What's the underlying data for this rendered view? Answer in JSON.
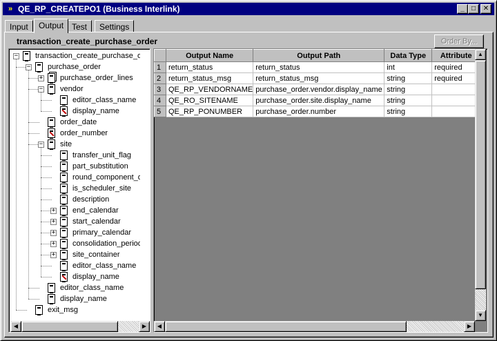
{
  "window": {
    "title": "QE_RP_CREATEPO1 (Business Interlink)",
    "controls": {
      "minimize": "_",
      "maximize": "□",
      "close": "✕"
    }
  },
  "tabs": [
    {
      "label": "Input",
      "active": false
    },
    {
      "label": "Output",
      "active": true
    },
    {
      "label": "Test",
      "active": false
    },
    {
      "label": "Settings",
      "active": false
    }
  ],
  "panel": {
    "title": "transaction_create_purchase_order",
    "order_by_label": "Order By..."
  },
  "tree": {
    "nodes": [
      {
        "label": "transaction_create_purchase_order",
        "level": 0,
        "expander": "−",
        "icon": "doc"
      },
      {
        "label": "purchase_order",
        "level": 1,
        "expander": "−",
        "icon": "doc"
      },
      {
        "label": "purchase_order_lines",
        "level": 2,
        "expander": "+",
        "icon": "multi-doc"
      },
      {
        "label": "vendor",
        "level": 2,
        "expander": "−",
        "icon": "doc"
      },
      {
        "label": "editor_class_name",
        "level": 3,
        "expander": "",
        "icon": "doc"
      },
      {
        "label": "display_name",
        "level": 3,
        "expander": "",
        "icon": "doc-red"
      },
      {
        "label": "order_date",
        "level": 2,
        "expander": "",
        "icon": "doc"
      },
      {
        "label": "order_number",
        "level": 2,
        "expander": "",
        "icon": "doc-red"
      },
      {
        "label": "site",
        "level": 2,
        "expander": "−",
        "icon": "doc"
      },
      {
        "label": "transfer_unit_flag",
        "level": 3,
        "expander": "",
        "icon": "doc"
      },
      {
        "label": "part_substitution",
        "level": 3,
        "expander": "",
        "icon": "doc"
      },
      {
        "label": "round_component_de",
        "level": 3,
        "expander": "",
        "icon": "doc"
      },
      {
        "label": "is_scheduler_site",
        "level": 3,
        "expander": "",
        "icon": "doc"
      },
      {
        "label": "description",
        "level": 3,
        "expander": "",
        "icon": "doc"
      },
      {
        "label": "end_calendar",
        "level": 3,
        "expander": "+",
        "icon": "doc"
      },
      {
        "label": "start_calendar",
        "level": 3,
        "expander": "+",
        "icon": "doc"
      },
      {
        "label": "primary_calendar",
        "level": 3,
        "expander": "+",
        "icon": "doc"
      },
      {
        "label": "consolidation_period_",
        "level": 3,
        "expander": "+",
        "icon": "doc"
      },
      {
        "label": "site_container",
        "level": 3,
        "expander": "+",
        "icon": "doc"
      },
      {
        "label": "editor_class_name",
        "level": 3,
        "expander": "",
        "icon": "doc"
      },
      {
        "label": "display_name",
        "level": 3,
        "expander": "",
        "icon": "doc-red"
      },
      {
        "label": "editor_class_name",
        "level": 2,
        "expander": "",
        "icon": "doc"
      },
      {
        "label": "display_name",
        "level": 2,
        "expander": "",
        "icon": "doc"
      },
      {
        "label": "exit_msg",
        "level": 1,
        "expander": "",
        "icon": "doc"
      }
    ]
  },
  "grid": {
    "columns": [
      "Output Name",
      "Output Path",
      "Data Type",
      "Attribute"
    ],
    "rows": [
      {
        "num": "1",
        "name": "return_status",
        "path": "return_status",
        "type": "int",
        "attr": "required"
      },
      {
        "num": "2",
        "name": "return_status_msg",
        "path": "return_status_msg",
        "type": "string",
        "attr": "required"
      },
      {
        "num": "3",
        "name": "QE_RP_VENDORNAME",
        "path": "purchase_order.vendor.display_name",
        "type": "string",
        "attr": ""
      },
      {
        "num": "4",
        "name": "QE_RO_SITENAME",
        "path": "purchase_order.site.display_name",
        "type": "string",
        "attr": ""
      },
      {
        "num": "5",
        "name": "QE_RP_PONUMBER",
        "path": "purchase_order.number",
        "type": "string",
        "attr": ""
      }
    ]
  },
  "colors": {
    "titlebar": "#000080",
    "face": "#c0c0c0",
    "disabled_text": "#808080",
    "required_flag_icon": "#c00000"
  },
  "icons": {
    "app": "app-icon",
    "tree_node": "document-icon",
    "tree_node_multi": "multi-document-icon",
    "tree_node_flagged": "flagged-document-icon"
  }
}
